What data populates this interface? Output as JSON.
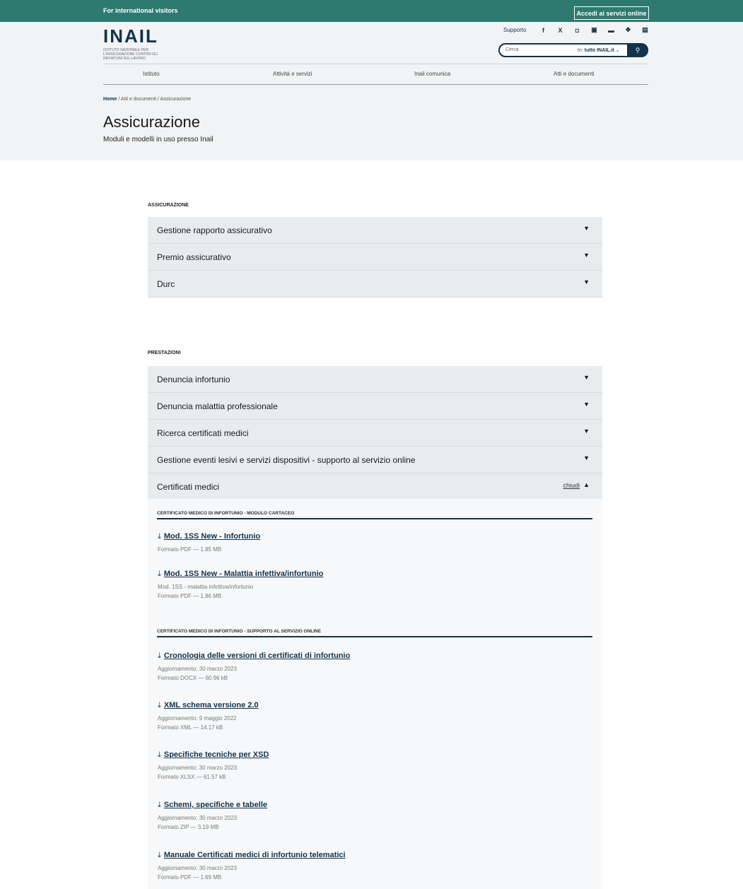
{
  "topbar": {
    "international": "For international visitors",
    "login_button": "Accedi ai servizi online"
  },
  "logo": {
    "name": "INAIL",
    "tagline": "ISTITUTO NAZIONALE PER L'ASSICURAZIONE CONTRO GLI INFORTUNI SUL LAVORO"
  },
  "utility": {
    "support": "Supporto",
    "socials": [
      "f",
      "X",
      "◘",
      "▣",
      "▬",
      "✥",
      "▤"
    ]
  },
  "search": {
    "placeholder": "Cerca",
    "scope_prefix": "In:",
    "scope_value": "tutto INAIL.it",
    "scope_caret": "⌄"
  },
  "nav": [
    "Istituto",
    "Attività e servizi",
    "Inail comunica",
    "Atti e documenti"
  ],
  "breadcrumb": {
    "home": "Home",
    "rest": " / Atti e documenti / Assicurazione"
  },
  "page": {
    "title": "Assicurazione",
    "subtitle": "Moduli e modelli in uso presso Inail"
  },
  "sections": [
    {
      "title": "ASSICURAZIONE",
      "items": [
        "Gestione rapporto assicurativo",
        "Premio assicurativo",
        "Durc"
      ]
    },
    {
      "title": "PRESTAZIONI",
      "items": [
        "Denuncia infortunio",
        "Denuncia malattia professionale",
        "Ricerca certificati medici",
        "Gestione eventi lesivi e servizi dispositivi - supporto al servizio online",
        "Certificati medici"
      ]
    }
  ],
  "open_item": {
    "close_label": "chiudi"
  },
  "groups": [
    {
      "title": "CERTIFICATO MEDICO DI INFORTUNIO - MODULO CARTACEO"
    },
    {
      "title": "CERTIFICATO MEDICO DI INFORTUNIO - SUPPORTO AL SERVIZIO ONLINE"
    }
  ],
  "files": [
    {
      "title": "Mod. 1SS New - Infortunio",
      "lines": [
        "Formato PDF — 1.85 MB"
      ]
    },
    {
      "title": "Mod. 1SS New - Malattia infettiva/infortunio",
      "lines": [
        "Mod. 1SS - malattia infettiva/infortunio",
        "Formato PDF — 1.86 MB"
      ]
    },
    {
      "title": "Cronologia delle versioni di certificati di infortunio",
      "lines": [
        "Aggiornamento: 30 marzo 2023",
        "Formato DOCX — 60.96 kB"
      ]
    },
    {
      "title": "XML schema versione 2.0",
      "lines": [
        "Aggiornamento: 9 maggio 2022",
        "Formato XML — 14.17 kB"
      ]
    },
    {
      "title": "Specifiche tecniche per XSD",
      "lines": [
        "Aggiornamento: 30 marzo 2023",
        "Formato XLSX — 61.57 kB"
      ]
    },
    {
      "title": "Schemi, specifiche e tabelle",
      "lines": [
        "Aggiornamento: 30 marzo 2023",
        "Formato ZIP — 3.19 MB"
      ]
    },
    {
      "title": "Manuale Certificati medici di infortunio telematici",
      "lines": [
        "Aggiornamento: 30 marzo 2023",
        "Formato PDF — 1.69 MB"
      ]
    }
  ],
  "icons": {
    "expand": "▼",
    "collapse": "▲",
    "download": "⤓",
    "search": "⚲"
  },
  "colors": {
    "brand": "#13324b",
    "topbar": "#2e7a70"
  }
}
